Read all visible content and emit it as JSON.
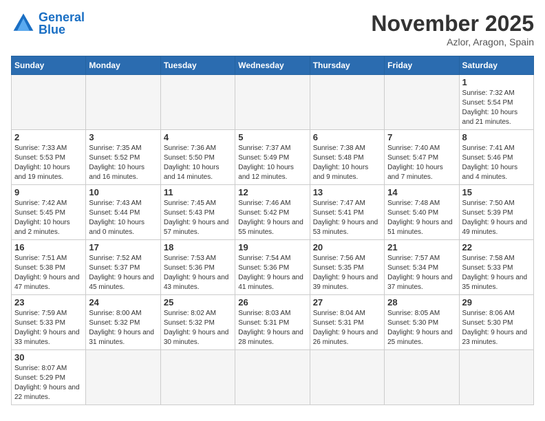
{
  "header": {
    "logo_general": "General",
    "logo_blue": "Blue",
    "month_title": "November 2025",
    "location": "Azlor, Aragon, Spain"
  },
  "days_of_week": [
    "Sunday",
    "Monday",
    "Tuesday",
    "Wednesday",
    "Thursday",
    "Friday",
    "Saturday"
  ],
  "weeks": [
    [
      {
        "day": "",
        "info": ""
      },
      {
        "day": "",
        "info": ""
      },
      {
        "day": "",
        "info": ""
      },
      {
        "day": "",
        "info": ""
      },
      {
        "day": "",
        "info": ""
      },
      {
        "day": "",
        "info": ""
      },
      {
        "day": "1",
        "info": "Sunrise: 7:32 AM\nSunset: 5:54 PM\nDaylight: 10 hours and 21 minutes."
      }
    ],
    [
      {
        "day": "2",
        "info": "Sunrise: 7:33 AM\nSunset: 5:53 PM\nDaylight: 10 hours and 19 minutes."
      },
      {
        "day": "3",
        "info": "Sunrise: 7:35 AM\nSunset: 5:52 PM\nDaylight: 10 hours and 16 minutes."
      },
      {
        "day": "4",
        "info": "Sunrise: 7:36 AM\nSunset: 5:50 PM\nDaylight: 10 hours and 14 minutes."
      },
      {
        "day": "5",
        "info": "Sunrise: 7:37 AM\nSunset: 5:49 PM\nDaylight: 10 hours and 12 minutes."
      },
      {
        "day": "6",
        "info": "Sunrise: 7:38 AM\nSunset: 5:48 PM\nDaylight: 10 hours and 9 minutes."
      },
      {
        "day": "7",
        "info": "Sunrise: 7:40 AM\nSunset: 5:47 PM\nDaylight: 10 hours and 7 minutes."
      },
      {
        "day": "8",
        "info": "Sunrise: 7:41 AM\nSunset: 5:46 PM\nDaylight: 10 hours and 4 minutes."
      }
    ],
    [
      {
        "day": "9",
        "info": "Sunrise: 7:42 AM\nSunset: 5:45 PM\nDaylight: 10 hours and 2 minutes."
      },
      {
        "day": "10",
        "info": "Sunrise: 7:43 AM\nSunset: 5:44 PM\nDaylight: 10 hours and 0 minutes."
      },
      {
        "day": "11",
        "info": "Sunrise: 7:45 AM\nSunset: 5:43 PM\nDaylight: 9 hours and 57 minutes."
      },
      {
        "day": "12",
        "info": "Sunrise: 7:46 AM\nSunset: 5:42 PM\nDaylight: 9 hours and 55 minutes."
      },
      {
        "day": "13",
        "info": "Sunrise: 7:47 AM\nSunset: 5:41 PM\nDaylight: 9 hours and 53 minutes."
      },
      {
        "day": "14",
        "info": "Sunrise: 7:48 AM\nSunset: 5:40 PM\nDaylight: 9 hours and 51 minutes."
      },
      {
        "day": "15",
        "info": "Sunrise: 7:50 AM\nSunset: 5:39 PM\nDaylight: 9 hours and 49 minutes."
      }
    ],
    [
      {
        "day": "16",
        "info": "Sunrise: 7:51 AM\nSunset: 5:38 PM\nDaylight: 9 hours and 47 minutes."
      },
      {
        "day": "17",
        "info": "Sunrise: 7:52 AM\nSunset: 5:37 PM\nDaylight: 9 hours and 45 minutes."
      },
      {
        "day": "18",
        "info": "Sunrise: 7:53 AM\nSunset: 5:36 PM\nDaylight: 9 hours and 43 minutes."
      },
      {
        "day": "19",
        "info": "Sunrise: 7:54 AM\nSunset: 5:36 PM\nDaylight: 9 hours and 41 minutes."
      },
      {
        "day": "20",
        "info": "Sunrise: 7:56 AM\nSunset: 5:35 PM\nDaylight: 9 hours and 39 minutes."
      },
      {
        "day": "21",
        "info": "Sunrise: 7:57 AM\nSunset: 5:34 PM\nDaylight: 9 hours and 37 minutes."
      },
      {
        "day": "22",
        "info": "Sunrise: 7:58 AM\nSunset: 5:33 PM\nDaylight: 9 hours and 35 minutes."
      }
    ],
    [
      {
        "day": "23",
        "info": "Sunrise: 7:59 AM\nSunset: 5:33 PM\nDaylight: 9 hours and 33 minutes."
      },
      {
        "day": "24",
        "info": "Sunrise: 8:00 AM\nSunset: 5:32 PM\nDaylight: 9 hours and 31 minutes."
      },
      {
        "day": "25",
        "info": "Sunrise: 8:02 AM\nSunset: 5:32 PM\nDaylight: 9 hours and 30 minutes."
      },
      {
        "day": "26",
        "info": "Sunrise: 8:03 AM\nSunset: 5:31 PM\nDaylight: 9 hours and 28 minutes."
      },
      {
        "day": "27",
        "info": "Sunrise: 8:04 AM\nSunset: 5:31 PM\nDaylight: 9 hours and 26 minutes."
      },
      {
        "day": "28",
        "info": "Sunrise: 8:05 AM\nSunset: 5:30 PM\nDaylight: 9 hours and 25 minutes."
      },
      {
        "day": "29",
        "info": "Sunrise: 8:06 AM\nSunset: 5:30 PM\nDaylight: 9 hours and 23 minutes."
      }
    ],
    [
      {
        "day": "30",
        "info": "Sunrise: 8:07 AM\nSunset: 5:29 PM\nDaylight: 9 hours and 22 minutes."
      },
      {
        "day": "",
        "info": ""
      },
      {
        "day": "",
        "info": ""
      },
      {
        "day": "",
        "info": ""
      },
      {
        "day": "",
        "info": ""
      },
      {
        "day": "",
        "info": ""
      },
      {
        "day": "",
        "info": ""
      }
    ]
  ]
}
